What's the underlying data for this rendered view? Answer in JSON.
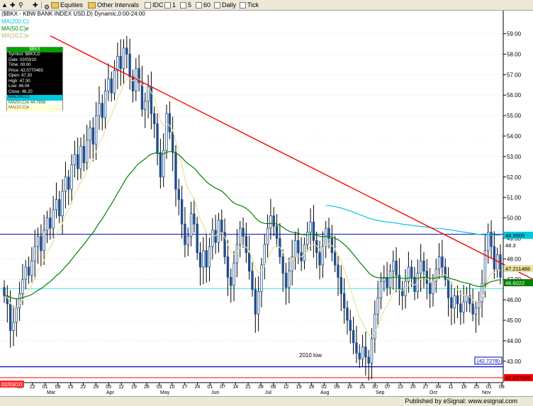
{
  "toolbar": {
    "items": [
      "Equities",
      "Other Intervals",
      "IDC",
      "1",
      "5",
      "60",
      "Daily",
      "Tick"
    ]
  },
  "title": "($BKX - KBW BANK INDEX USD,D) Dynamic,0:00-24:00",
  "legend": {
    "ma1": "MA(200,C)",
    "ma2": "MA(50,C)e",
    "ma3": "MA(10,C)e"
  },
  "data_window": {
    "header": "$BKX",
    "rows": [
      {
        "label": "Symbol",
        "value": "$BKX,D"
      },
      {
        "label": "Date",
        "value": "02/03/10"
      },
      {
        "label": "Time",
        "value": "00:00"
      },
      {
        "label": "Price",
        "value": "42.0770483"
      },
      {
        "label": "Open",
        "value": "47.30"
      },
      {
        "label": "High",
        "value": "47.30"
      },
      {
        "label": "Low",
        "value": "46.04"
      },
      {
        "label": "Close",
        "value": "46.20"
      }
    ],
    "ma_rows": [
      {
        "label": "MA(200,C)",
        "value": ""
      },
      {
        "label": "MA(50,C)e",
        "value": "44.7856"
      },
      {
        "label": "MA(10,C)e",
        "value": ""
      }
    ]
  },
  "footer": {
    "published": "Published by eSignal: www.esignal.com",
    "date_box": "02/03/10"
  },
  "colors": {
    "candle": "#1f4e8c",
    "trendline": "#ff0000",
    "ma200": "#00c8e0",
    "ma50": "#008000",
    "ma10": "#e8e0a0",
    "hline": "#0000c0",
    "cyan_line": "#40e0e0"
  },
  "chart_data": {
    "type": "candlestick",
    "title": "($BKX - KBW BANK INDEX USD,D) Dynamic,0:00-24:00",
    "ylim": [
      42.3,
      59.4
    ],
    "y_ticks": [
      "59.00",
      "58.00",
      "57.00",
      "56.00",
      "55.00",
      "54.00",
      "53.00",
      "52.00",
      "51.00",
      "50.00",
      "49.00",
      "48.00",
      "47.00",
      "46.00",
      "45.00",
      "44.00",
      "43.00"
    ],
    "x_day_labels": [
      "15",
      "22",
      "01",
      "08",
      "15",
      "22",
      "29",
      "05",
      "12",
      "19",
      "26",
      "03",
      "10",
      "17",
      "24",
      "01",
      "07",
      "14",
      "21",
      "28",
      "06",
      "12",
      "19",
      "26",
      "02",
      "09",
      "16",
      "23",
      "30",
      "07",
      "13",
      "20",
      "27",
      "04",
      "11",
      "18",
      "25",
      "01",
      "08"
    ],
    "x_month_labels": [
      "Mar",
      "Apr",
      "May",
      "Jun",
      "Jul",
      "Aug",
      "Sep",
      "Oct",
      "Nov"
    ],
    "annotations": [
      {
        "text": "2010 low",
        "x": "02",
        "y": 43.0
      },
      {
        "text": "(42.7278)",
        "y": 42.7278
      }
    ],
    "price_markers": [
      {
        "value": "48.9000",
        "color": "#00c8e0"
      },
      {
        "value": "48.3",
        "color": "#ffffff"
      },
      {
        "value": "47.211488",
        "color": "#e8e0a0"
      },
      {
        "value": "46.6022",
        "color": "#008000"
      },
      {
        "value": "42.077048",
        "color": "#ff0000"
      }
    ],
    "levels": {
      "resistance": 49.2,
      "support_2010_low": 42.7278,
      "cyan_level": 46.55
    },
    "trendline": {
      "start": {
        "x": 15,
        "y": 58.9
      },
      "end": {
        "x": 178,
        "y": 46.6
      }
    },
    "closes": [
      46.2,
      45.8,
      44.5,
      44.9,
      45.6,
      46.3,
      47.0,
      47.6,
      47.2,
      47.9,
      48.6,
      49.1,
      48.4,
      49.4,
      50.0,
      49.5,
      50.4,
      50.9,
      50.1,
      51.3,
      52.0,
      51.4,
      52.6,
      53.1,
      52.4,
      53.5,
      52.7,
      53.8,
      54.4,
      53.6,
      55.0,
      55.6,
      54.9,
      56.2,
      56.8,
      56.1,
      57.2,
      57.9,
      57.3,
      58.3,
      58.0,
      56.9,
      56.2,
      57.3,
      56.6,
      55.3,
      55.7,
      56.4,
      55.1,
      54.6,
      53.2,
      52.0,
      53.3,
      55.1,
      54.2,
      53.2,
      51.4,
      50.9,
      49.7,
      48.7,
      49.1,
      50.2,
      49.7,
      48.3,
      47.6,
      48.4,
      47.6,
      48.6,
      49.4,
      48.8,
      49.9,
      49.3,
      48.1,
      47.1,
      46.7,
      47.8,
      48.7,
      49.5,
      49.1,
      48.3,
      47.4,
      46.5,
      45.3,
      46.4,
      47.7,
      48.7,
      49.5,
      50.1,
      49.6,
      49.0,
      48.1,
      47.3,
      46.6,
      47.4,
      48.1,
      48.9,
      48.3,
      47.9,
      48.7,
      49.3,
      49.8,
      48.9,
      48.3,
      47.7,
      48.6,
      49.5,
      49.0,
      48.3,
      47.7,
      47.1,
      46.3,
      45.6,
      45.0,
      44.5,
      43.9,
      43.4,
      43.1,
      43.7,
      43.2,
      42.9,
      44.1,
      45.3,
      46.1,
      46.9,
      47.1,
      46.6,
      47.4,
      47.9,
      47.2,
      46.5,
      46.2,
      46.9,
      47.6,
      47.1,
      46.4,
      47.3,
      47.9,
      47.4,
      46.8,
      46.3,
      46.9,
      47.5,
      48.1,
      47.6,
      47.0,
      46.1,
      45.6,
      46.2,
      45.8,
      45.4,
      45.9,
      46.2,
      45.8,
      45.3,
      45.6,
      45.9,
      46.8,
      48.4,
      49.3,
      48.6,
      47.5,
      48.2,
      47.1
    ]
  }
}
